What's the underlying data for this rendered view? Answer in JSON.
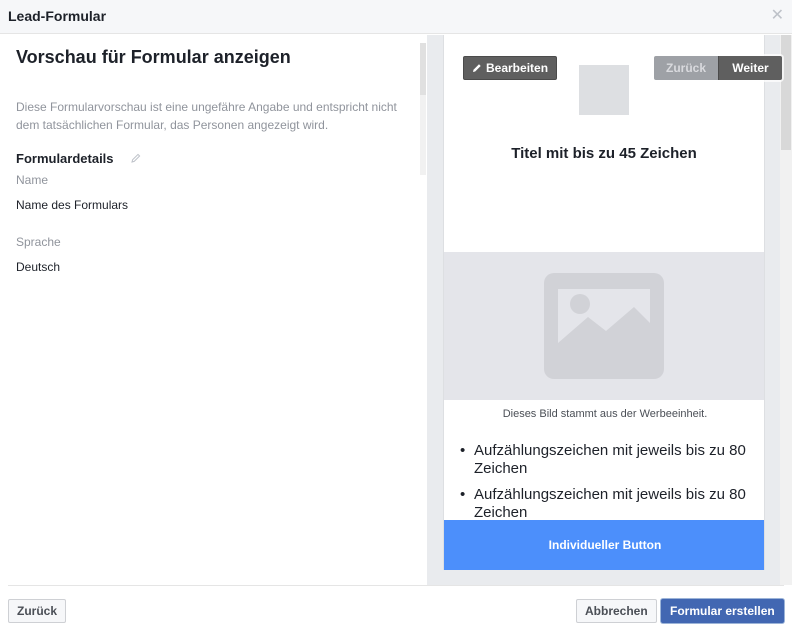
{
  "dialog": {
    "title": "Lead-Formular",
    "close_icon": "close-icon"
  },
  "left": {
    "heading": "Vorschau für Formular anzeigen",
    "description": "Diese Formularvorschau ist eine ungefähre Angabe und entspricht nicht dem tatsächlichen Formular, das Personen angezeigt wird.",
    "section_title": "Formulardetails",
    "fields": [
      {
        "label": "Name",
        "value": "Name des Formulars"
      },
      {
        "label": "Sprache",
        "value": "Deutsch"
      }
    ]
  },
  "preview": {
    "edit_label": "Bearbeiten",
    "prev_label": "Zurück",
    "next_label": "Weiter",
    "title": "Titel mit bis zu 45 Zeichen",
    "image_caption": "Dieses Bild stammt aus der Werbeeinheit.",
    "bullets": [
      "Aufzählungszeichen mit jeweils bis zu 80 Zeichen",
      "Aufzählungszeichen mit jeweils bis zu 80 Zeichen"
    ],
    "custom_button": "Individueller Button"
  },
  "footer": {
    "back_label": "Zurück",
    "cancel_label": "Abbrechen",
    "create_label": "Formular erstellen"
  },
  "colors": {
    "primary": "#4267b2",
    "custom_button": "#4c8ffb",
    "preview_bg": "#e9ebee"
  }
}
